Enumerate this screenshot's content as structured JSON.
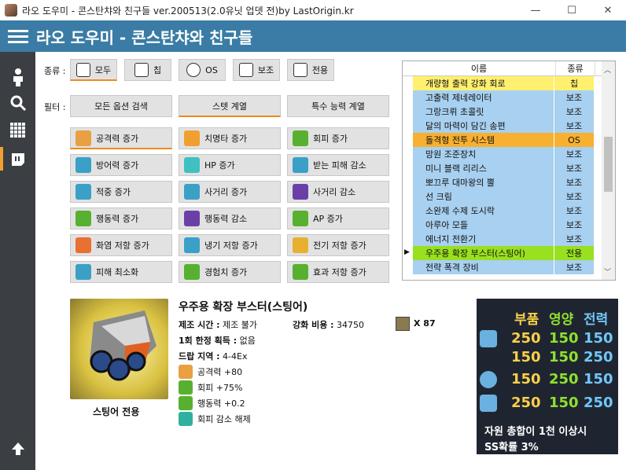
{
  "window": {
    "title": "라오 도우미 - 콘스탄챠와 친구들 ver.200513(2.0유닛 업뎃 전)by LastOrigin.kr",
    "min": "—",
    "max": "☐",
    "close": "✕"
  },
  "header": {
    "title": "라오 도우미 - 콘스탄챠와 친구들"
  },
  "sidebar": {
    "items": [
      "person-icon",
      "search-icon",
      "grid-icon",
      "parts-icon"
    ],
    "bottom": "arrow-up-icon"
  },
  "type_filter": {
    "label": "종류 :",
    "options": [
      "모두",
      "칩",
      "OS",
      "보조",
      "전용"
    ],
    "selected": "모두"
  },
  "filter": {
    "label": "필터 :",
    "tabs": [
      "모든 옵션 검색",
      "스텟 계열",
      "특수 능력 계열"
    ],
    "selected": "스텟 계열"
  },
  "stat_buttons": [
    [
      "공격력 증가",
      "치명타 증가",
      "회피 증가"
    ],
    [
      "방어력 증가",
      "HP 증가",
      "받는 피해 감소"
    ],
    [
      "적중 증가",
      "사거리 증가",
      "사거리 감소"
    ],
    [
      "행동력 증가",
      "행동력 감소",
      "AP 증가"
    ],
    [
      "화염 저항 증가",
      "냉기 저항 증가",
      "전기 저항 증가"
    ],
    [
      "피해 최소화",
      "경험치 증가",
      "효과 저항 증가"
    ]
  ],
  "stat_colors": [
    [
      "#e8a040",
      "#f0a030",
      "#58b030"
    ],
    [
      "#3aa0c8",
      "#40c0c0",
      "#3aa0c8"
    ],
    [
      "#3aa0c8",
      "#3aa0c8",
      "#6a40a8"
    ],
    [
      "#58b030",
      "#6a40a8",
      "#58b030"
    ],
    [
      "#e87030",
      "#3aa0c8",
      "#e8b030"
    ],
    [
      "#3aa0c8",
      "#58b030",
      "#58b030"
    ]
  ],
  "list": {
    "headers": [
      "이름",
      "종류"
    ],
    "rows": [
      {
        "name": "개량형 출력 강화 회로",
        "type": "칩",
        "color": "#fff070"
      },
      {
        "name": "고출력 제네레이터",
        "type": "보조",
        "color": "#a8d0f0"
      },
      {
        "name": "그랑크뤼 초콜릿",
        "type": "보조",
        "color": "#a8d0f0"
      },
      {
        "name": "달의 마력이 담긴 송편",
        "type": "보조",
        "color": "#a8d0f0"
      },
      {
        "name": "돌격형 전투 시스템",
        "type": "OS",
        "color": "#f8b030"
      },
      {
        "name": "망원 조준장치",
        "type": "보조",
        "color": "#a8d0f0"
      },
      {
        "name": "미니 블랙 리리스",
        "type": "보조",
        "color": "#a8d0f0"
      },
      {
        "name": "뽀끄루 대마왕의 뿔",
        "type": "보조",
        "color": "#a8d0f0"
      },
      {
        "name": "선 크림",
        "type": "보조",
        "color": "#a8d0f0"
      },
      {
        "name": "소완제 수제 도시락",
        "type": "보조",
        "color": "#a8d0f0"
      },
      {
        "name": "아루아 모들",
        "type": "보조",
        "color": "#a8d0f0"
      },
      {
        "name": "에너지 전환기",
        "type": "보조",
        "color": "#a8d0f0"
      },
      {
        "name": "우주용 확장 부스터(스팅어)",
        "type": "전용",
        "color": "#98e020",
        "selected": true
      },
      {
        "name": "전략 폭격 장비",
        "type": "보조",
        "color": "#a8d0f0"
      }
    ]
  },
  "detail": {
    "name": "우주용 확장 부스터(스팅어)",
    "caption": "스팅어 전용",
    "craft_label": "제조 시간 :",
    "craft_value": "제조 불가",
    "enh_label": "강화 비용 :",
    "enh_value": "34750",
    "mult": "X 87",
    "limit_label": "1회 한정 획득 :",
    "limit_value": "없음",
    "drop_label": "드랍 지역 :",
    "drop_value": "4-4Ex",
    "effects": [
      {
        "name": "공격력 +80",
        "color": "#e8a040"
      },
      {
        "name": "회피 +75%",
        "color": "#58b030"
      },
      {
        "name": "행동력 +0.2",
        "color": "#58b030"
      },
      {
        "name": "회피 감소 해제",
        "color": "#30b0a0"
      }
    ]
  },
  "resource_panel": {
    "headers": [
      {
        "t": "부품",
        "c": "#f8d048"
      },
      {
        "t": "영양",
        "c": "#90e030"
      },
      {
        "t": "전력",
        "c": "#70c8f8"
      }
    ],
    "rows": [
      [
        "250",
        "150",
        "150"
      ],
      [
        "150",
        "150",
        "250"
      ],
      [
        "150",
        "250",
        "150"
      ],
      [
        "250",
        "150",
        "250"
      ]
    ],
    "colors": [
      "#f8d048",
      "#90e030",
      "#70c8f8"
    ],
    "note1": "자원 총합이 1천 이상시",
    "note2": "SS확률 3%"
  }
}
